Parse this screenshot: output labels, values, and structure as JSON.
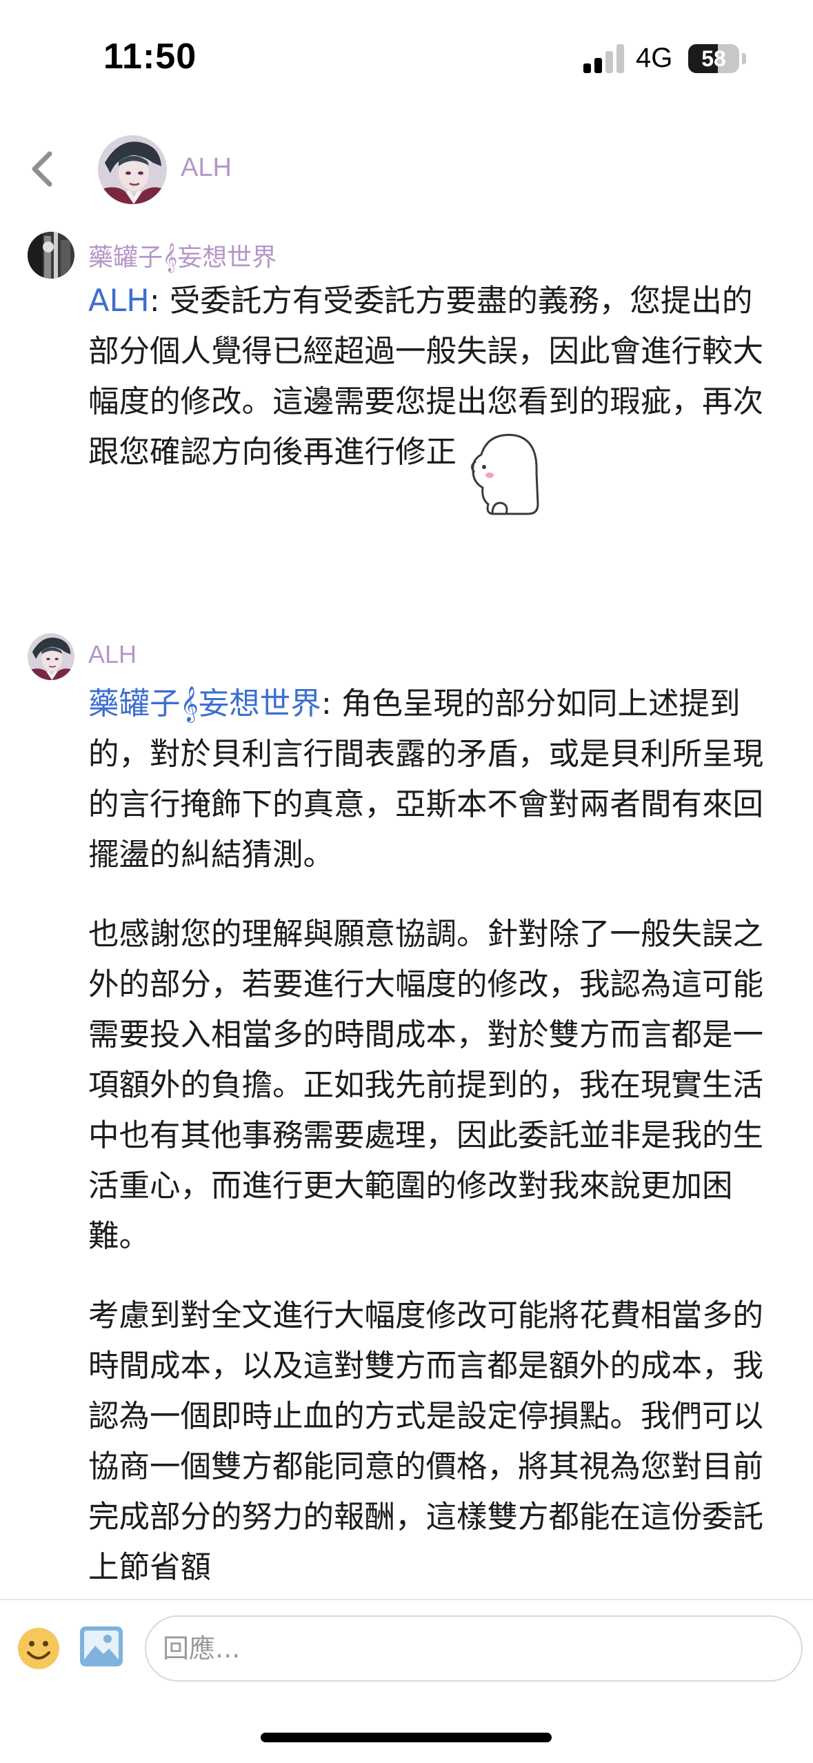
{
  "status_bar": {
    "time": "11:50",
    "network": "4G",
    "battery": "58",
    "battery_level": 0.58,
    "signal_bars_active": 2,
    "signal_bars_total": 4
  },
  "header": {
    "back_icon": "chevron-left-icon",
    "name": "ALH"
  },
  "messages": [
    {
      "author": "藥罐子𝄞妄想世界",
      "mention": "ALH",
      "paragraphs": [
        ": 受委託方有受委託方要盡的義務，您提出的部分個人覺得已經超過一般失誤，因此會進行較大幅度的修改。這邊需要您提出您看到的瑕疵，再次跟您確認方向後再進行修正"
      ],
      "sticker": "white-blob-sticker"
    },
    {
      "author": "ALH",
      "mention": "藥罐子𝄞妄想世界",
      "paragraphs": [
        ": 角色呈現的部分如同上述提到的，對於貝利言行間表露的矛盾，或是貝利所呈現的言行掩飾下的真意，亞斯本不會對兩者間有來回擺盪的糾結猜測。",
        "也感謝您的理解與願意協調。針對除了一般失誤之外的部分，若要進行大幅度的修改，我認為這可能需要投入相當多的時間成本，對於雙方而言都是一項額外的負擔。正如我先前提到的，我在現實生活中也有其他事務需要處理，因此委託並非是我的生活重心，而進行更大範圍的修改對我來說更加困難。",
        "考慮到對全文進行大幅度修改可能將花費相當多的時間成本，以及這對雙方而言都是額外的成本，我認為一個即時止血的方式是設定停損點。我們可以協商一個雙方都能同意的價格，將其視為您對目前完成部分的努力的報酬，這樣雙方都能在這份委託上節省額"
      ]
    }
  ],
  "composer": {
    "emoji_icon": "smiley-icon",
    "photo_icon": "photo-icon",
    "placeholder": "回應..."
  },
  "colors": {
    "author_name": "#b596c8",
    "mention": "#3d6fd0",
    "text": "#1c1c1c",
    "back_chevron": "#8e8e93",
    "emoji_yellow": "#f6c75a",
    "photo_blue": "#7fb3dd"
  }
}
